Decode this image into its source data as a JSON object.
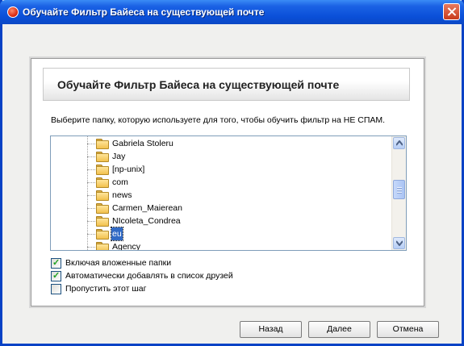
{
  "window": {
    "title": "Обучайте Фильтр Байеса на существующей почте"
  },
  "header": {
    "title": "Обучайте Фильтр Байеса на существующей почте"
  },
  "instruction": "Выберите папку, которую используете для того, чтобы обучить фильтр на НЕ СПАМ.",
  "folders": [
    {
      "label": "Gabriela Stoleru",
      "selected": false
    },
    {
      "label": "Jay",
      "selected": false
    },
    {
      "label": "[np-unix]",
      "selected": false
    },
    {
      "label": "com",
      "selected": false
    },
    {
      "label": "news",
      "selected": false
    },
    {
      "label": "Carmen_Maierean",
      "selected": false
    },
    {
      "label": "NIcoleta_Condrea",
      "selected": false
    },
    {
      "label": "eu",
      "selected": true
    },
    {
      "label": "Agency",
      "selected": false
    }
  ],
  "options": [
    {
      "label": "Включая вложенные папки",
      "checked": true
    },
    {
      "label": "Автоматически добавлять в список друзей",
      "checked": true
    },
    {
      "label": "Пропустить этот шаг",
      "checked": false
    }
  ],
  "buttons": {
    "back": "Назад",
    "next": "Далее",
    "cancel": "Отмена"
  },
  "icons": {
    "app": "app-logo-icon",
    "close": "close-icon",
    "folder": "folder-icon",
    "scroll_up": "scroll-up-arrow-icon",
    "scroll_down": "scroll-down-arrow-icon"
  },
  "colors": {
    "titlebar": "#0a4fd8",
    "selection": "#316ac5",
    "close": "#c83b1b"
  }
}
